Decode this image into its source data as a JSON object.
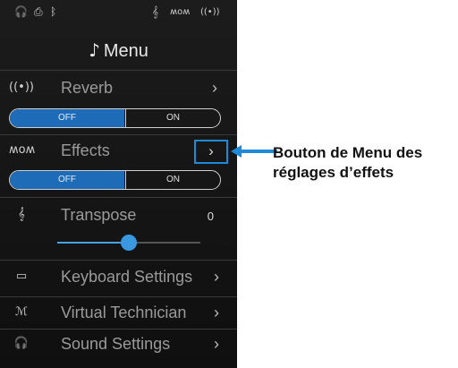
{
  "status_bar": {
    "icons": [
      "headphones-icon",
      "usb-icon",
      "bluetooth-icon",
      "transpose-icon",
      "effects-icon",
      "reverb-icon"
    ],
    "glyphs": [
      "🎧",
      "⎙",
      "ᛒ",
      "𝄞",
      "ʍᴏʍ",
      "((•))"
    ]
  },
  "header": {
    "icon": "music-note-icon",
    "icon_glyph": "♪",
    "title": "Menu"
  },
  "reverb": {
    "icon_glyph": "((•))",
    "label": "Reverb",
    "chevron": "›",
    "off": "OFF",
    "on": "ON",
    "state": "OFF"
  },
  "effects": {
    "icon_glyph": "ʍᴏʍ",
    "label": "Effects",
    "chevron": "›",
    "off": "OFF",
    "on": "ON",
    "state": "OFF"
  },
  "transpose": {
    "icon_glyph": "𝄞",
    "label": "Transpose",
    "value": "0",
    "slider_position": 0.5
  },
  "menu_items": [
    {
      "icon": "keyboard-icon",
      "glyph": "▭",
      "label": "Keyboard Settings",
      "chevron": "›"
    },
    {
      "icon": "virtual-technician-icon",
      "glyph": "ℳ",
      "label": "Virtual Technician",
      "chevron": "›"
    },
    {
      "icon": "headphones-icon",
      "glyph": "🎧",
      "label": "Sound Settings",
      "chevron": "›"
    }
  ],
  "callout": {
    "text_line1": "Bouton de Menu des",
    "text_line2": "réglages d’effets",
    "color": "#1f8ad6"
  },
  "colors": {
    "accent": "#1e6bb8",
    "highlight": "#1f8ad6",
    "background": "#141414"
  }
}
